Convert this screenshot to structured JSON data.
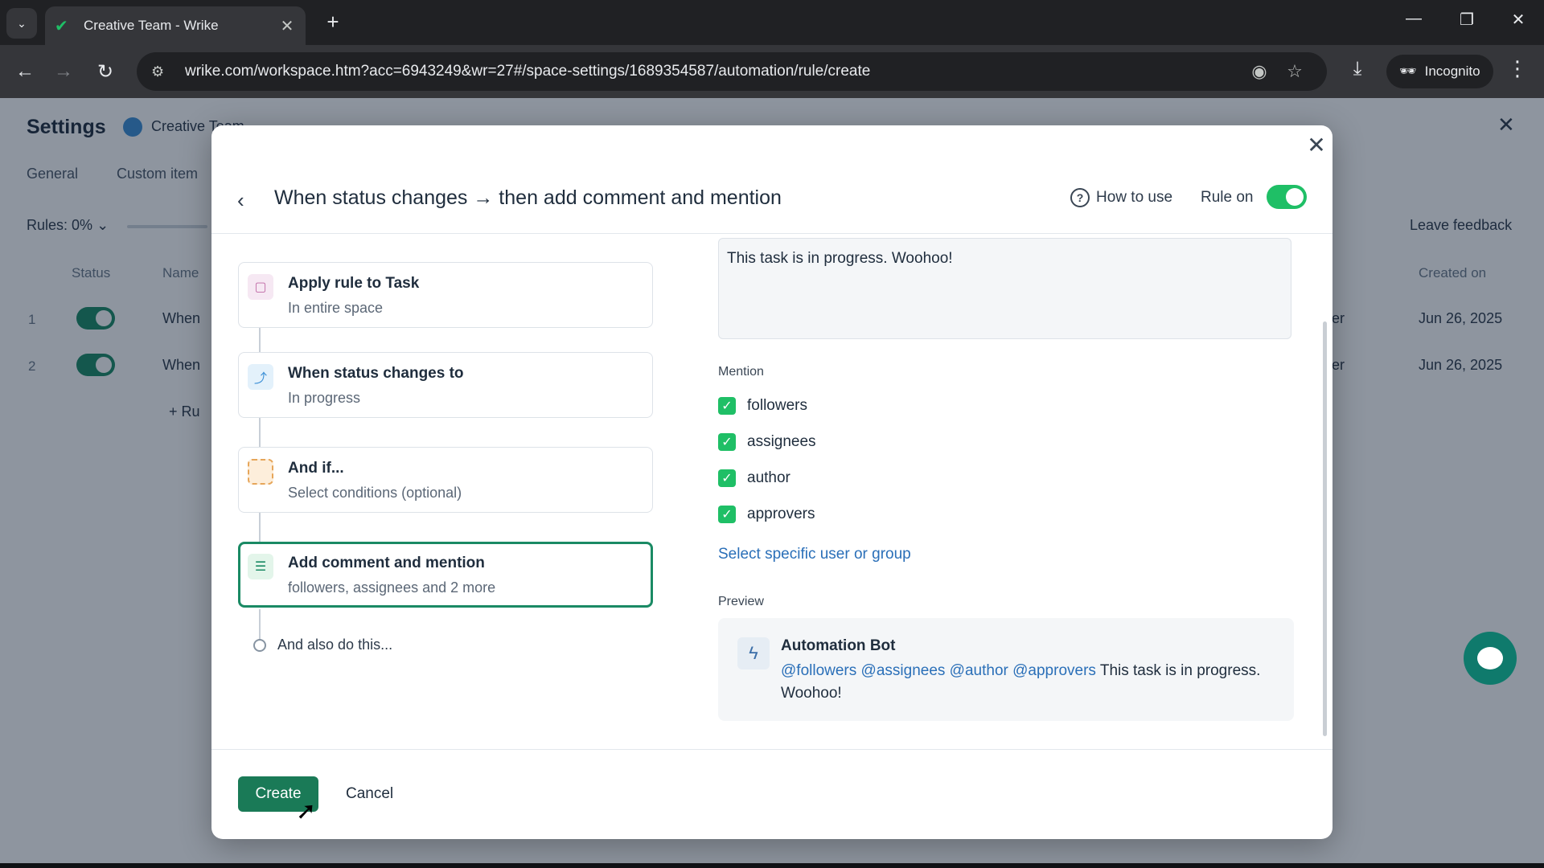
{
  "browser": {
    "tab_title": "Creative Team - Wrike",
    "url": "wrike.com/workspace.htm?acc=6943249&wr=27#/space-settings/1689354587/automation/rule/create",
    "incognito_label": "Incognito"
  },
  "background": {
    "settings_title": "Settings",
    "space_name": "Creative Team",
    "tabs": [
      "General",
      "Custom item"
    ],
    "rules_label": "Rules: 0%",
    "leave_feedback": "Leave feedback",
    "columns": {
      "status": "Status",
      "name": "Name",
      "created_on": "Created on"
    },
    "rows": [
      {
        "num": "1",
        "name": "When",
        "frag": "ler",
        "date": "Jun 26, 2025"
      },
      {
        "num": "2",
        "name": "When",
        "frag": "ler",
        "date": "Jun 26, 2025"
      }
    ],
    "add_rule": "+ Ru"
  },
  "modal": {
    "title": "When status changes → then add comment and mention",
    "how_to_use": "How to use",
    "rule_on_label": "Rule on",
    "rule_on": true,
    "steps": [
      {
        "title": "Apply rule to Task",
        "subtitle": "In entire space",
        "icon": "task-icon",
        "color": "#f6e8f3"
      },
      {
        "title": "When status changes to",
        "subtitle": "In progress",
        "icon": "status-change-icon",
        "color": "#e3f1fb"
      },
      {
        "title": "And if...",
        "subtitle": "Select conditions (optional)",
        "icon": "condition-icon",
        "color": "#fdeedb"
      },
      {
        "title": "Add comment and mention",
        "subtitle": "followers, assignees and 2 more",
        "icon": "comment-icon",
        "color": "#e3f5ea"
      }
    ],
    "also_do": "And also do this...",
    "comment_text": "This task is in progress. Woohoo!",
    "mention_label": "Mention",
    "mentions": [
      "followers",
      "assignees",
      "author",
      "approvers"
    ],
    "select_specific": "Select specific user or group",
    "preview_label": "Preview",
    "preview": {
      "bot_name": "Automation Bot",
      "mention_tags": [
        "@followers",
        "@assignees",
        "@author",
        "@approvers"
      ],
      "message": "This task is in progress. Woohoo!"
    },
    "create_label": "Create",
    "cancel_label": "Cancel"
  },
  "colors": {
    "accent": "#1a7a57",
    "toggle_on": "#1fbf66",
    "link": "#2a6fb8"
  }
}
